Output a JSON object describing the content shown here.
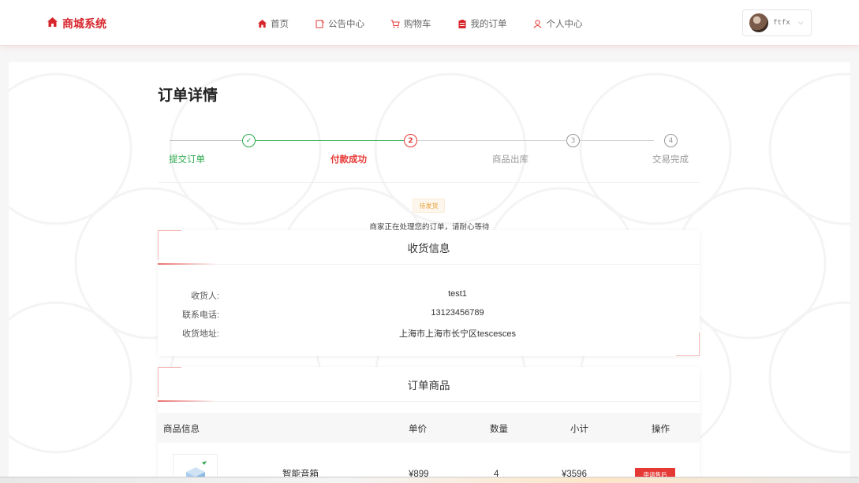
{
  "app": {
    "name": "商城系统"
  },
  "nav": {
    "items": [
      {
        "label": "首页",
        "icon": "home-icon"
      },
      {
        "label": "公告中心",
        "icon": "notice-icon"
      },
      {
        "label": "购物车",
        "icon": "cart-icon"
      },
      {
        "label": "我的订单",
        "icon": "order-icon"
      },
      {
        "label": "个人中心",
        "icon": "user-icon"
      }
    ]
  },
  "user": {
    "name": "ftfx"
  },
  "page": {
    "title": "订单详情"
  },
  "steps": [
    {
      "label": "提交订单",
      "marker": "✓",
      "state": "done"
    },
    {
      "label": "付款成功",
      "marker": "2",
      "state": "current"
    },
    {
      "label": "商品出库",
      "marker": "3",
      "state": "pending"
    },
    {
      "label": "交易完成",
      "marker": "4",
      "state": "pending"
    }
  ],
  "status": {
    "badge": "待发货",
    "description": "商家正在处理您的订单，请耐心等待"
  },
  "shipping": {
    "title": "收货信息",
    "rows": [
      {
        "label": "收货人:",
        "value": "test1"
      },
      {
        "label": "联系电话:",
        "value": "13123456789"
      },
      {
        "label": "收货地址:",
        "value": "上海市上海市长宁区tescesces"
      }
    ]
  },
  "order_items": {
    "title": "订单商品",
    "columns": [
      "商品信息",
      "单价",
      "数量",
      "小计",
      "操作"
    ],
    "rows": [
      {
        "name": "智能音箱",
        "price": "¥899",
        "qty": "4",
        "subtotal": "¥3596",
        "action": "申请售后"
      }
    ]
  },
  "colors": {
    "brand": "#d7262c",
    "done": "#2aa84a",
    "current": "#e53935",
    "pending": "#999999",
    "badge_bg": "#fdf6ec",
    "badge_text": "#e6a23c"
  }
}
